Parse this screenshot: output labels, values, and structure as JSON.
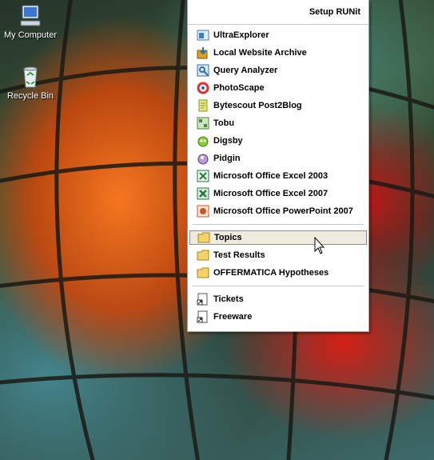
{
  "desktop": {
    "icons": [
      {
        "label": "My Computer",
        "icon": "my-computer-icon"
      },
      {
        "label": "Recycle Bin",
        "icon": "recycle-bin-icon"
      }
    ]
  },
  "menu": {
    "header": "Setup RUNit",
    "apps": [
      {
        "label": "UltraExplorer",
        "icon": "ultraexplorer-icon",
        "color": "#3a7bd5"
      },
      {
        "label": "Local Website Archive",
        "icon": "website-archive-icon",
        "color": "#e0a020"
      },
      {
        "label": "Query Analyzer",
        "icon": "query-analyzer-icon",
        "color": "#2a6fb0"
      },
      {
        "label": "PhotoScape",
        "icon": "photoscape-icon",
        "color": "#e03030"
      },
      {
        "label": "Bytescout Post2Blog",
        "icon": "post2blog-icon",
        "color": "#6aa02a"
      },
      {
        "label": "Tobu",
        "icon": "tobu-icon",
        "color": "#4a8a3a"
      },
      {
        "label": "Digsby",
        "icon": "digsby-icon",
        "color": "#6ab02a"
      },
      {
        "label": "Pidgin",
        "icon": "pidgin-icon",
        "color": "#8a5ab0"
      },
      {
        "label": "Microsoft Office Excel 2003",
        "icon": "excel-2003-icon",
        "color": "#1f7a3a"
      },
      {
        "label": "Microsoft Office Excel 2007",
        "icon": "excel-2007-icon",
        "color": "#1f7a3a"
      },
      {
        "label": "Microsoft Office PowerPoint 2007",
        "icon": "powerpoint-2007-icon",
        "color": "#d2501e"
      }
    ],
    "folders": [
      {
        "label": "Topics",
        "icon": "folder-icon",
        "hovered": true
      },
      {
        "label": "Test Results",
        "icon": "folder-icon"
      },
      {
        "label": "OFFERMATICA Hypotheses",
        "icon": "folder-icon"
      }
    ],
    "shortcuts": [
      {
        "label": "Tickets",
        "icon": "shortcut-icon"
      },
      {
        "label": "Freeware",
        "icon": "shortcut-icon"
      }
    ]
  }
}
